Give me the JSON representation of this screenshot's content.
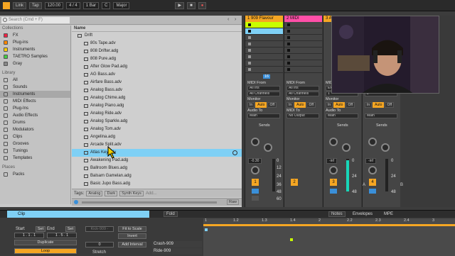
{
  "topbar": {
    "link": "Link",
    "tap": "Tap",
    "tempo": "120.00",
    "time_sig": "4 / 4",
    "quantize": "1 Bar",
    "key": "C",
    "scale": "Major",
    "play": "▶",
    "stop": "■",
    "record": "●"
  },
  "browser": {
    "search_placeholder": "Search (Cmd + F)",
    "name_header": "Name",
    "collections_header": "Collections",
    "collections": [
      "FX",
      "Plug-ins",
      "Instruments",
      "TAETRO Samples",
      "Gray"
    ],
    "library_header": "Library",
    "library": [
      "All",
      "Sounds",
      "Instruments",
      "MIDI Effects",
      "Plug-Ins",
      "Audio Effects",
      "Drums",
      "Modulators",
      "Clips",
      "Grooves",
      "Tunings",
      "Templates"
    ],
    "places_header": "Places",
    "places": [
      "Packs"
    ],
    "folder": "Drift",
    "files": [
      "80s Tape.adv",
      "808 Drifter.adg",
      "808 Pure.adg",
      "After Glow Pad.adg",
      "AG Bass.adv",
      "Airfare Bass.adv",
      "Analog Bass.adv",
      "Analog Chime.adg",
      "Analog Piano.adg",
      "Analog Ride.adv",
      "Analog Sparkle.adg",
      "Analog Tom.adv",
      "Angelina.adg",
      "Arcade Split.adv",
      "Atlas Key.adv",
      "Awakening Pad.adg",
      "Ballroom Blues.adg",
      "Balsam Gamelan.adg",
      "Basic Jupo Bass.adg"
    ],
    "selected_file": "Atlas Key.adv",
    "tags_label": "Tags:",
    "tags": [
      "Analog",
      "Dark",
      "Synth Keys",
      "Add..."
    ],
    "raw": "Raw"
  },
  "mixer": {
    "tracks": [
      {
        "name": "1 909 Flavour",
        "color": "#f5a623",
        "num": "1",
        "vol": "-0.30"
      },
      {
        "name": "2 MIDI",
        "color": "#ff4fa8",
        "num": "2",
        "vol": ""
      },
      {
        "name": "3 A",
        "color": "#f5a623",
        "num": "3",
        "vol": "-inf"
      },
      {
        "name": "4",
        "color": "#f5a623",
        "num": "4",
        "vol": "-inf"
      }
    ],
    "midi_from": "MIDI From",
    "all_ins": "All Ins",
    "all_channels": "All Channels",
    "monitor": "Monitor",
    "in": "In",
    "auto": "Auto",
    "off": "Off",
    "audio_to": "Audio To",
    "midi_to": "MIDI To",
    "main": "Main",
    "no_output": "No Output",
    "sends": "Sends",
    "scale": [
      "0",
      "12",
      "24",
      "36",
      "48",
      "60"
    ],
    "ch1_num": "1",
    "ch1_clips": "16",
    "ch2_num": "2",
    "sends_letters": [
      "A",
      "B"
    ],
    "ext": "Ext",
    "ch3_num": "1",
    "ch4_num": "2"
  },
  "clip": {
    "title": "Clip",
    "fold": "Fold",
    "notes_tab": "Notes",
    "envelopes_tab": "Envelopes",
    "mpe_tab": "MPE",
    "start": "Start",
    "end": "End",
    "set": "Set",
    "start_val": "1 . 1 . 1",
    "end_val": "1 . 5 . 1",
    "duplicate": "Duplicate",
    "loop": "Loop",
    "clip_name": "Kick-909 -",
    "fit_to_scale": "Fit to Scale",
    "invert": "Invert",
    "add_interval": "Add Interval",
    "interval_val": "0",
    "stretch": "Stretch",
    "rows": [
      "Crash-909",
      "Ride-909"
    ],
    "ruler": [
      "1",
      "1.2",
      "1.3",
      "1.4",
      "2",
      "2.2",
      "2.3",
      "2.4",
      "3"
    ]
  }
}
